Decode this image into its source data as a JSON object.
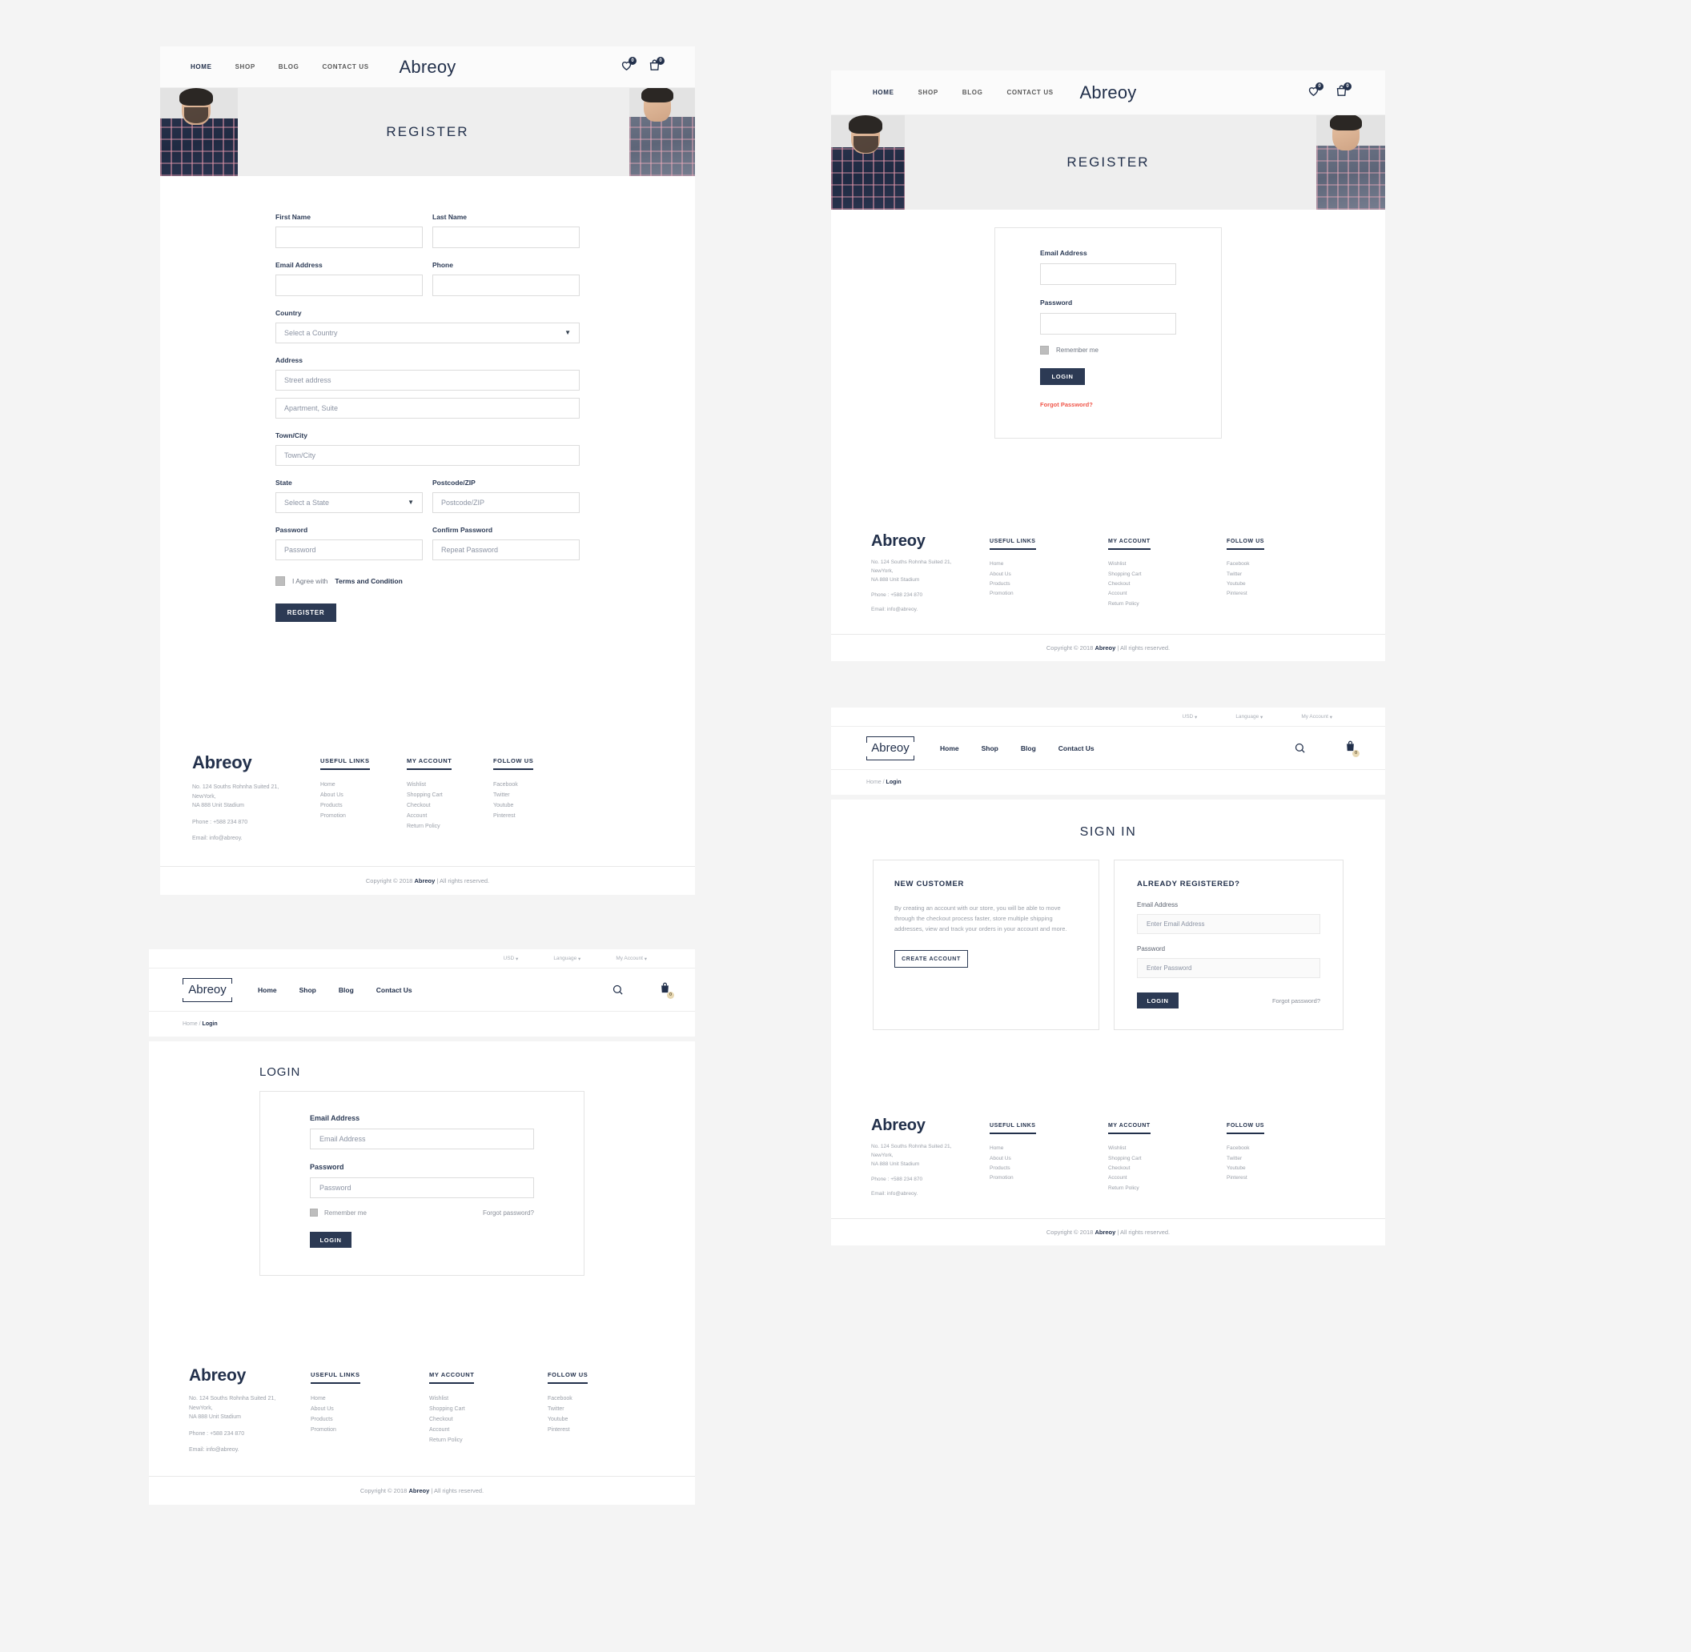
{
  "brand": "Abreoy",
  "colors": {
    "navy": "#2c3a54",
    "page_bg": "#f4f4f4",
    "hero_bg": "#eeeeee",
    "muted": "#9a9fa8",
    "red_link": "#f0564a",
    "bag_badge": "#e8d9b4"
  },
  "nav_center": {
    "items": [
      {
        "label": "HOME",
        "active": true
      },
      {
        "label": "SHOP",
        "active": false
      },
      {
        "label": "BLOG",
        "active": false
      },
      {
        "label": "CONTACT US",
        "active": false
      }
    ],
    "wishlist_count": "0",
    "cart_count": "0"
  },
  "nav_left": {
    "items": [
      {
        "label": "Home"
      },
      {
        "label": "Shop"
      },
      {
        "label": "Blog"
      },
      {
        "label": "Contact Us"
      }
    ],
    "cart_count": "0"
  },
  "utilbar": {
    "currency": "USD",
    "language": "Language",
    "account": "My Account",
    "caret": "▾"
  },
  "breadcrumb": {
    "home": "Home",
    "sep": "/",
    "current": "Login"
  },
  "register_page": {
    "hero_title": "REGISTER",
    "fields": {
      "first_name_label": "First Name",
      "first_name_value": "",
      "last_name_label": "Last Name",
      "last_name_value": "",
      "email_label": "Email Address",
      "email_value": "",
      "phone_label": "Phone",
      "phone_value": "",
      "country_label": "Country",
      "country_placeholder": "Select a Country",
      "address_label": "Address",
      "street_placeholder": "Street address",
      "apartment_placeholder": "Apartment, Suite",
      "town_label": "Town/City",
      "town_placeholder": "Town/City",
      "state_label": "State",
      "state_placeholder": "Select a State",
      "postcode_label": "Postcode/ZIP",
      "postcode_placeholder": "Postcode/ZIP",
      "password_label": "Password",
      "password_placeholder": "Password",
      "confirm_label": "Confirm Password",
      "confirm_placeholder": "Repeat Password"
    },
    "agree_prefix": "I Agree with",
    "agree_terms": "Terms and Condition",
    "submit_label": "REGISTER"
  },
  "register_login_card": {
    "hero_title": "REGISTER",
    "email_label": "Email Address",
    "email_value": "",
    "password_label": "Password",
    "password_value": "",
    "remember_label": "Remember me",
    "login_label": "LOGIN",
    "forgot_label": "Forgot Password?"
  },
  "login_page": {
    "title": "LOGIN",
    "email_label": "Email Address",
    "email_placeholder": "Email Address",
    "password_label": "Password",
    "password_placeholder": "Password",
    "remember_label": "Remember me",
    "forgot_label": "Forgot password?",
    "login_label": "LOGIN"
  },
  "signin_page": {
    "title": "SIGN IN",
    "new_customer": {
      "heading": "NEW CUSTOMER",
      "body": "By creating an account with our store, you will be able to move through the checkout process faster, store multiple shipping addresses, view and track your orders in your account and more.",
      "button": "CREATE ACCOUNT"
    },
    "registered": {
      "heading": "ALREADY REGISTERED?",
      "email_label": "Email Address",
      "email_placeholder": "Enter Email Address",
      "password_label": "Password",
      "password_placeholder": "Enter Password",
      "login_label": "LOGIN",
      "forgot_label": "Forgot password?"
    }
  },
  "footer": {
    "brand": "Abreoy",
    "address_line1": "No. 124 Souths Rohnha Suited 21,",
    "address_line2": "NewYork,",
    "address_line3": "NA 888 Unit Stadium",
    "phone": "Phone : +588 234 870",
    "email": "Email: info@abreoy.",
    "columns": [
      {
        "heading": "USEFUL LINKS",
        "links": [
          "Home",
          "About Us",
          "Products",
          "Promotion"
        ]
      },
      {
        "heading": "MY ACCOUNT",
        "links": [
          "Wishlist",
          "Shopping Cart",
          "Checkout",
          "Account",
          "Return Policy"
        ]
      },
      {
        "heading": "FOLLOW US",
        "links": [
          "Facebook",
          "Twitter",
          "Youtube",
          "Pinterest"
        ]
      }
    ],
    "copyright_prefix": "Copyright © 2018",
    "copyright_brand": "Abreoy",
    "copyright_suffix": "| All rights reserved."
  }
}
